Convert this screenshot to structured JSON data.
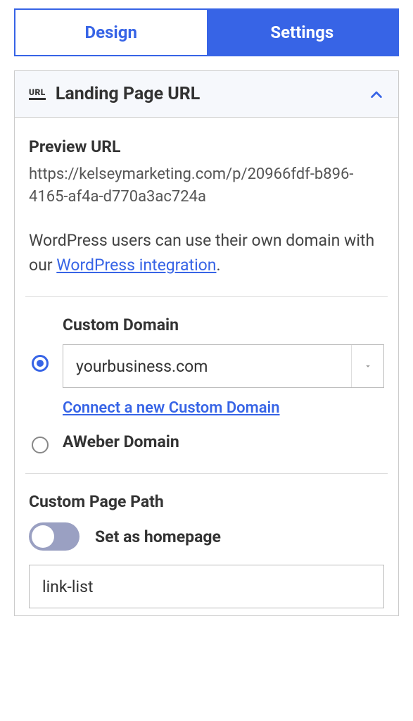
{
  "tabs": {
    "design": "Design",
    "settings": "Settings"
  },
  "panel": {
    "icon_text": "URL",
    "title": "Landing Page URL"
  },
  "preview": {
    "label": "Preview URL",
    "url": "https://kelseymarketing.com/p/20966fdf-b896-4165-af4a-d770a3ac724a"
  },
  "wordpress": {
    "text_before": "WordPress users can use their own domain with our ",
    "link_text": "WordPress integration",
    "text_after": "."
  },
  "domain": {
    "custom_label": "Custom Domain",
    "selected": "yourbusiness.com",
    "connect_link": "Connect a new Custom Domain",
    "aweber_label": "AWeber Domain"
  },
  "path": {
    "label": "Custom Page Path",
    "toggle_label": "Set as homepage",
    "value": "link-list"
  }
}
